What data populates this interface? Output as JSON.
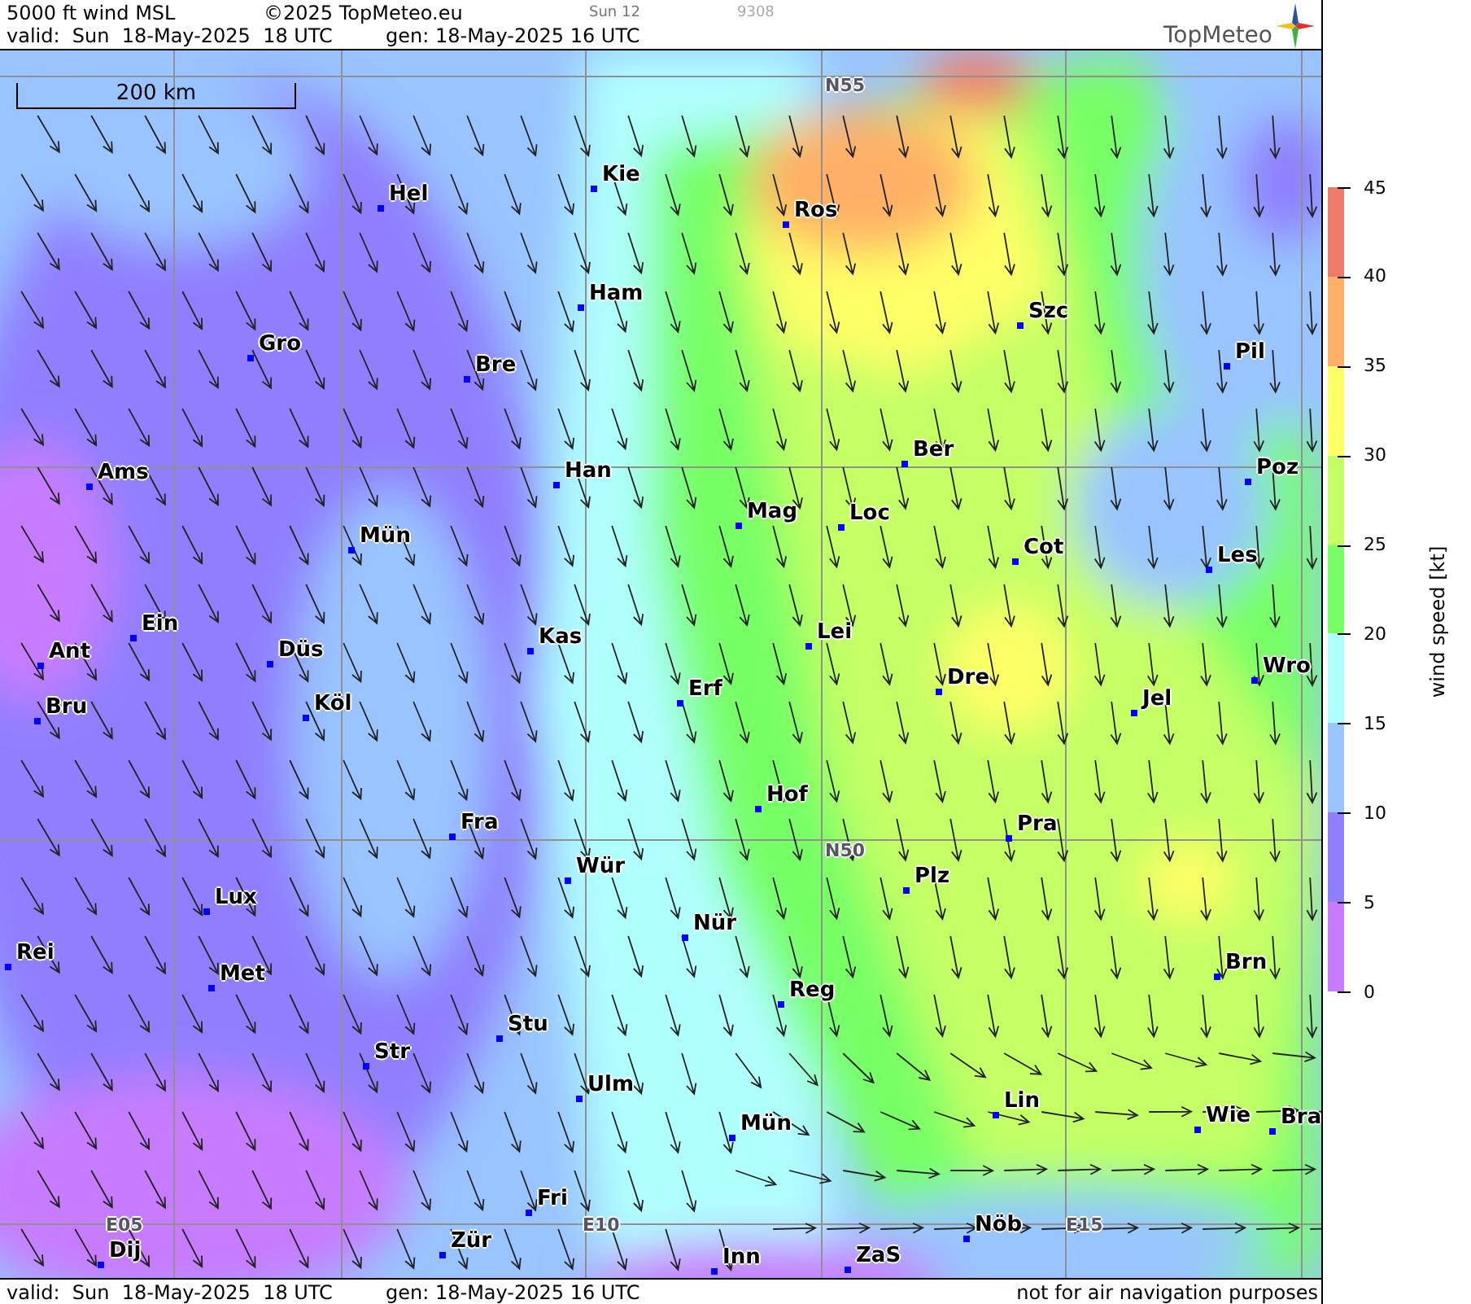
{
  "header": {
    "title": "5000 ft wind MSL",
    "copyright": "©2025 TopMeteo.eu",
    "run": "Sun 12",
    "code": "9308",
    "valid": "valid:  Sun  18-May-2025  18 UTC",
    "generated": "gen: 18-May-2025 16 UTC",
    "logo": "TopMeteo"
  },
  "map": {
    "scale_bar": "200 km",
    "grid_labels": [
      "N55",
      "N50",
      "E05",
      "E10",
      "E15"
    ],
    "cities": [
      {
        "name": "Hel"
      },
      {
        "name": "Kie"
      },
      {
        "name": "Ros"
      },
      {
        "name": "Ham"
      },
      {
        "name": "Gro"
      },
      {
        "name": "Bre"
      },
      {
        "name": "Szc"
      },
      {
        "name": "Pil"
      },
      {
        "name": "Ber"
      },
      {
        "name": "Ams"
      },
      {
        "name": "Han"
      },
      {
        "name": "Poz"
      },
      {
        "name": "Mag"
      },
      {
        "name": "Loc"
      },
      {
        "name": "Mün"
      },
      {
        "name": "Cot"
      },
      {
        "name": "Les"
      },
      {
        "name": "Ein"
      },
      {
        "name": "Kas"
      },
      {
        "name": "Lei"
      },
      {
        "name": "Ant"
      },
      {
        "name": "Düs"
      },
      {
        "name": "Wro"
      },
      {
        "name": "Erf"
      },
      {
        "name": "Dre"
      },
      {
        "name": "Bru"
      },
      {
        "name": "Köl"
      },
      {
        "name": "Jel"
      },
      {
        "name": "Hof"
      },
      {
        "name": "Fra"
      },
      {
        "name": "Pra"
      },
      {
        "name": "Wür"
      },
      {
        "name": "Plz"
      },
      {
        "name": "Lux"
      },
      {
        "name": "Nür"
      },
      {
        "name": "Rei"
      },
      {
        "name": "Met"
      },
      {
        "name": "Brn"
      },
      {
        "name": "Reg"
      },
      {
        "name": "Stu"
      },
      {
        "name": "Str"
      },
      {
        "name": "Ulm"
      },
      {
        "name": "Mün"
      },
      {
        "name": "Lin"
      },
      {
        "name": "Wie"
      },
      {
        "name": "Bra"
      },
      {
        "name": "Fri"
      },
      {
        "name": "Dij"
      },
      {
        "name": "Zür"
      },
      {
        "name": "Inn"
      },
      {
        "name": "ZaS"
      },
      {
        "name": "Nöb"
      }
    ]
  },
  "legend": {
    "title": "wind speed [kt]",
    "ticks": [
      "45",
      "40",
      "35",
      "30",
      "25",
      "20",
      "15",
      "10",
      "5",
      "0"
    ],
    "bands": [
      {
        "color": "#f07a6a"
      },
      {
        "color": "#ffb066"
      },
      {
        "color": "#ffff66"
      },
      {
        "color": "#c4ff66"
      },
      {
        "color": "#77ff66"
      },
      {
        "color": "#b0ffff"
      },
      {
        "color": "#99c4ff"
      },
      {
        "color": "#8f7fff"
      },
      {
        "color": "#c77cff"
      }
    ]
  },
  "footer": {
    "valid": "valid:  Sun  18-May-2025  18 UTC",
    "generated": "gen: 18-May-2025 16 UTC",
    "disclaimer": "not for air navigation purposes"
  }
}
